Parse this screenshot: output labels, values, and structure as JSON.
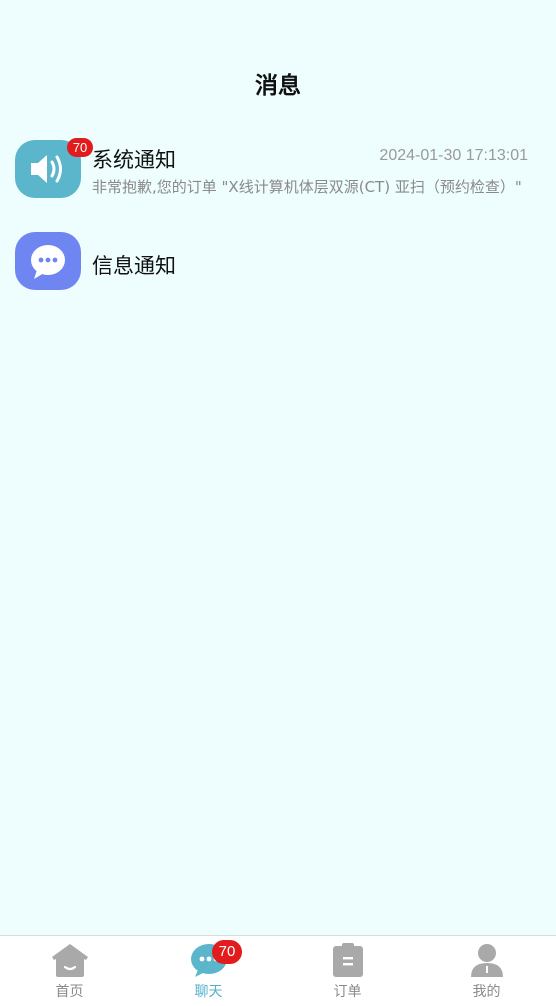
{
  "header": {
    "title": "消息"
  },
  "messages": [
    {
      "title": "系统通知",
      "badge": "70",
      "time": "2024-01-30 17:13:01",
      "preview": "非常抱歉,您的订单 \"X线计算机体层双源(CT) 亚扫（预约检查）\"",
      "icon": "speaker-icon",
      "icon_color": "#5bb6cc"
    },
    {
      "title": "信息通知",
      "icon": "chat-bubble-icon",
      "icon_color": "#6f86f2"
    }
  ],
  "tabbar": {
    "items": [
      {
        "label": "首页",
        "icon": "home-icon"
      },
      {
        "label": "聊天",
        "icon": "chat-icon",
        "badge": "70",
        "active": true
      },
      {
        "label": "订单",
        "icon": "order-icon"
      },
      {
        "label": "我的",
        "icon": "profile-icon"
      }
    ],
    "active_color": "#4fb2c9",
    "inactive_color": "#8a8a8a"
  }
}
